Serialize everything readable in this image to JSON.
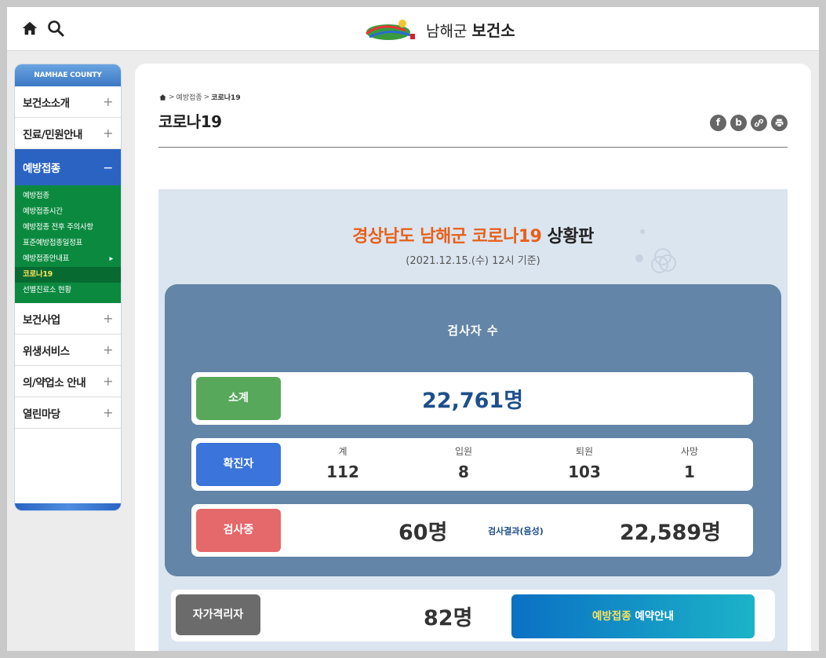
{
  "header": {
    "logo_name": "남해군",
    "logo_bold": "보건소",
    "home_icon": "home-icon",
    "search_icon": "search-icon"
  },
  "sidebar": {
    "head": "NAMHAE COUNTY",
    "items": [
      {
        "label": "보건소소개",
        "toggle": "+"
      },
      {
        "label": "진료/민원안내",
        "toggle": "+"
      },
      {
        "label": "예방접종",
        "toggle": "−"
      },
      {
        "label": "보건사업",
        "toggle": "+"
      },
      {
        "label": "위생서비스",
        "toggle": "+"
      },
      {
        "label": "의/약업소 안내",
        "toggle": "+"
      },
      {
        "label": "열린마당",
        "toggle": "+"
      }
    ],
    "sub": [
      {
        "label": "예방접종"
      },
      {
        "label": "예방접종시간"
      },
      {
        "label": "예방접종 전후 주의사항"
      },
      {
        "label": "표준예방접종일정표"
      },
      {
        "label": "예방접종안내표",
        "arrow": "▸"
      },
      {
        "label": "코로나19"
      },
      {
        "label": "선별진료소 현황"
      }
    ]
  },
  "breadcrumb": {
    "level1": "예방접종",
    "level2": "코로나19",
    "sep": ">"
  },
  "page": {
    "title": "코로나19",
    "share": {
      "facebook": "f",
      "blog": "b",
      "link": "🔗",
      "print": "🖶"
    }
  },
  "board": {
    "title_highlight": "경상남도 남해군 코로나19",
    "title_tail": "상황판",
    "date": "(2021.12.15.(수) 12시 기준)",
    "panel_title": "검사자 수",
    "subtotal": {
      "label": "소계",
      "value": "22,761명"
    },
    "confirmed": {
      "label": "확진자",
      "cols": [
        {
          "label": "계",
          "value": "112"
        },
        {
          "label": "입원",
          "value": "8"
        },
        {
          "label": "퇴원",
          "value": "103"
        },
        {
          "label": "사망",
          "value": "1"
        }
      ]
    },
    "testing": {
      "label": "검사중",
      "value": "60명",
      "neg_label": "검사결과(음성)",
      "neg_value": "22,589명"
    },
    "quarantine": {
      "label": "자가격리자",
      "value": "82명"
    },
    "reserve": {
      "highlight": "예방접종",
      "rest": " 예약안내"
    }
  }
}
